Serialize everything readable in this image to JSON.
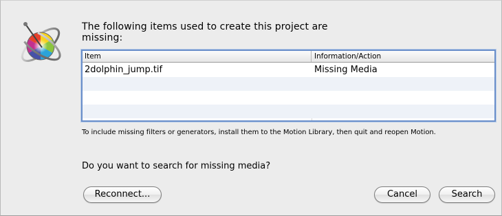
{
  "dialog": {
    "message": "The following items used to create this project are missing:",
    "table": {
      "columns": [
        "Item",
        "Information/Action"
      ],
      "rows": [
        {
          "item": "2dolphin_jump.tif",
          "info": "Missing Media"
        },
        {
          "item": "",
          "info": ""
        },
        {
          "item": "",
          "info": ""
        },
        {
          "item": "",
          "info": ""
        }
      ]
    },
    "note": "To include missing filters or generators, install them to the Motion Library, then quit and reopen Motion.",
    "question": "Do you want to search for missing media?",
    "buttons": {
      "reconnect": "Reconnect...",
      "cancel": "Cancel",
      "search": "Search"
    }
  },
  "icons": {
    "app": "motion-app-icon"
  },
  "colors": {
    "table_focus_border": "#6a8fca",
    "stripe": "#eef2f8",
    "dialog_bg": "#ececec"
  }
}
